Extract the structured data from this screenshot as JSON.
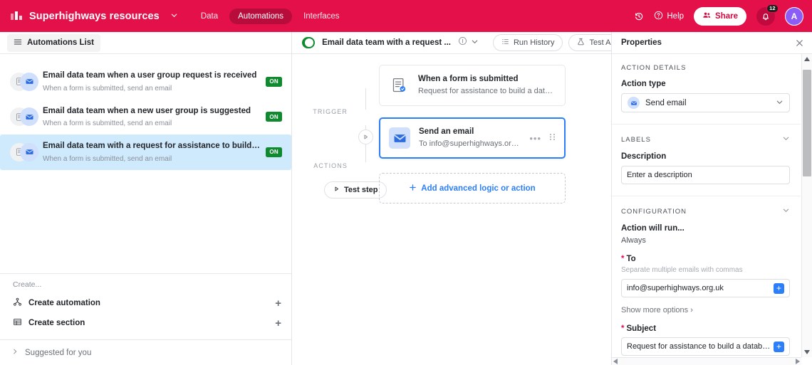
{
  "header": {
    "logo_icon": "bar-chart-logo-icon",
    "brand": "Superhighways resources",
    "brand_caret_icon": "chevron-down-icon",
    "nav": [
      {
        "label": "Data",
        "active": false
      },
      {
        "label": "Automations",
        "active": true
      },
      {
        "label": "Interfaces",
        "active": false
      }
    ],
    "history_icon": "history-clock-icon",
    "help_icon": "question-circle-icon",
    "help_label": "Help",
    "share_icon": "people-icon",
    "share_label": "Share",
    "bell_icon": "bell-icon",
    "notification_count": "12",
    "avatar_initial": "A",
    "bg_color": "#e3104a",
    "nav_active_bg": "#b70c3c",
    "avatar_color": "#8b5cf6"
  },
  "sidebar": {
    "list_button": {
      "icon": "hamburger-icon",
      "label": "Automations List"
    },
    "automations": [
      {
        "title": "Email data team when a user group request is received",
        "subtitle": "When a form is submitted, send an email",
        "status": "ON",
        "selected": false
      },
      {
        "title": "Email data team when a new user group is suggested",
        "subtitle": "When a form is submitted, send an email",
        "status": "ON",
        "selected": false
      },
      {
        "title": "Email data team with a request for assistance to build a database",
        "subtitle": "When a form is submitted, send an email",
        "status": "ON",
        "selected": true
      }
    ],
    "create_label": "Create...",
    "create_items": [
      {
        "icon": "automation-node-icon",
        "label": "Create automation",
        "action_icon": "plus-icon"
      },
      {
        "icon": "table-grid-icon",
        "label": "Create section",
        "action_icon": "plus-icon"
      }
    ],
    "suggested": {
      "icon": "chevron-right-icon",
      "label": "Suggested for you"
    },
    "selected_bg": "#cfeafd",
    "on_badge_color": "#0f8a2e"
  },
  "canvas": {
    "toggle_label": "ON",
    "flow_title": "Email data team with a request ...",
    "info_icon": "info-circle-icon",
    "title_caret_icon": "chevron-down-icon",
    "run_history": {
      "icon": "list-lines-icon",
      "label": "Run History"
    },
    "test_automation": {
      "icon": "flask-icon",
      "label": "Test Automation"
    },
    "trigger_rail_label": "TRIGGER",
    "actions_rail_label": "ACTIONS",
    "trigger_node_icon": "play-triangle-icon",
    "test_step": {
      "icon": "play-triangle-icon",
      "label": "Test step"
    },
    "trigger_card": {
      "icon": "form-document-check-icon",
      "title": "When a form is submitted",
      "subtitle": "Request for assistance to build a database"
    },
    "action_card": {
      "icon": "envelope-icon",
      "title": "Send an email",
      "subtitle": "To info@superhighways.org.uk",
      "more_icon": "ellipsis-icon",
      "drag_icon": "drag-handle-icon"
    },
    "add_action": {
      "icon": "plus-icon",
      "label": "Add advanced logic or action"
    },
    "selected_border_color": "#2d7ff9"
  },
  "properties": {
    "title": "Properties",
    "close_icon": "close-icon",
    "action_details": {
      "section_label": "ACTION DETAILS",
      "action_type_label": "Action type",
      "action_type_value": "Send email",
      "action_type_icon": "envelope-icon",
      "chevron_icon": "chevron-down-icon"
    },
    "labels": {
      "section_label": "LABELS",
      "collapse_icon": "chevron-down-icon",
      "description_label": "Description",
      "description_placeholder": "Enter a description",
      "description_value": ""
    },
    "configuration": {
      "section_label": "CONFIGURATION",
      "collapse_icon": "chevron-down-icon",
      "run_label": "Action will run...",
      "run_value": "Always",
      "to_label": "To",
      "to_hint": "Separate multiple emails with commas",
      "to_value": "info@superhighways.org.uk",
      "to_add_icon": "plus-square-icon",
      "show_more": "Show more options",
      "show_more_icon": "chevron-right-icon",
      "subject_label": "Subject",
      "subject_value": "Request for assistance to build a database",
      "subject_add_icon": "plus-square-icon"
    },
    "scrollbar": {
      "up_icon": "caret-up-icon",
      "down_icon": "caret-down-icon",
      "left_icon": "caret-left-icon",
      "right_icon": "caret-right-icon"
    }
  }
}
